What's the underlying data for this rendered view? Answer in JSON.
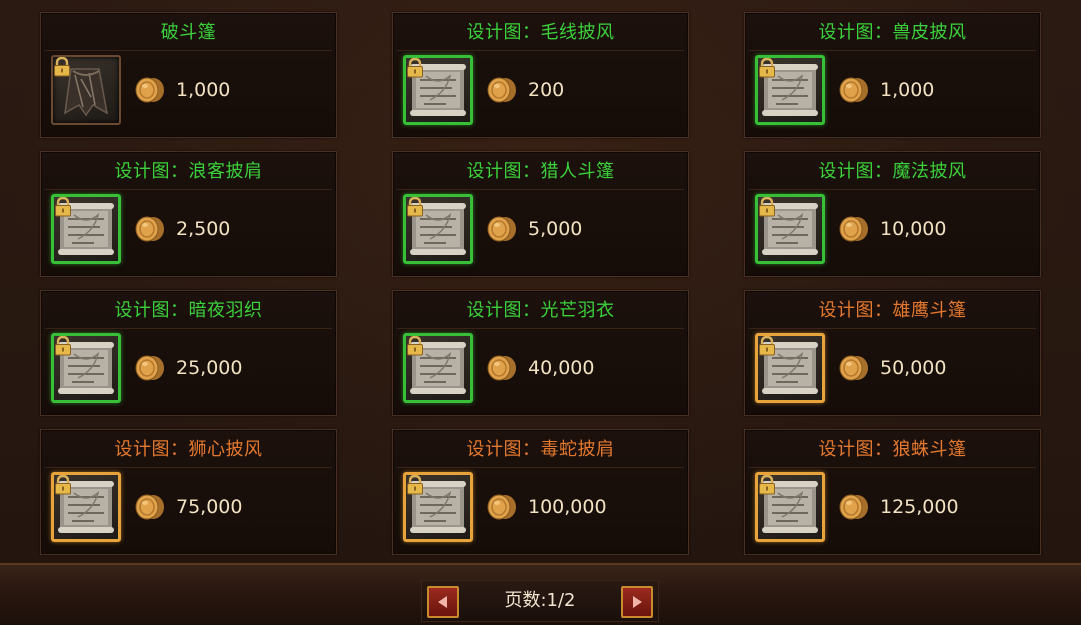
{
  "items": [
    {
      "title": "破斗篷",
      "price": "1,000",
      "rarity": "green",
      "icon": "cloak-icon",
      "frame": "plain"
    },
    {
      "title": "设计图：毛线披风",
      "price": "200",
      "rarity": "green",
      "icon": "scroll-icon",
      "frame": "green"
    },
    {
      "title": "设计图：兽皮披风",
      "price": "1,000",
      "rarity": "green",
      "icon": "scroll-icon",
      "frame": "green"
    },
    {
      "title": "设计图：浪客披肩",
      "price": "2,500",
      "rarity": "green",
      "icon": "scroll-icon",
      "frame": "green"
    },
    {
      "title": "设计图：猎人斗篷",
      "price": "5,000",
      "rarity": "green",
      "icon": "scroll-icon",
      "frame": "green"
    },
    {
      "title": "设计图：魔法披风",
      "price": "10,000",
      "rarity": "green",
      "icon": "scroll-icon",
      "frame": "green"
    },
    {
      "title": "设计图：暗夜羽织",
      "price": "25,000",
      "rarity": "green",
      "icon": "scroll-icon",
      "frame": "green"
    },
    {
      "title": "设计图：光芒羽衣",
      "price": "40,000",
      "rarity": "green",
      "icon": "scroll-icon",
      "frame": "green"
    },
    {
      "title": "设计图：雄鹰斗篷",
      "price": "50,000",
      "rarity": "orange",
      "icon": "scroll-icon",
      "frame": "orange"
    },
    {
      "title": "设计图：狮心披风",
      "price": "75,000",
      "rarity": "orange",
      "icon": "scroll-icon",
      "frame": "orange"
    },
    {
      "title": "设计图：毒蛇披肩",
      "price": "100,000",
      "rarity": "orange",
      "icon": "scroll-icon",
      "frame": "orange"
    },
    {
      "title": "设计图：狼蛛斗篷",
      "price": "125,000",
      "rarity": "orange",
      "icon": "scroll-icon",
      "frame": "orange"
    }
  ],
  "pagination": {
    "label": "页数:1/2",
    "prev_icon": "arrow-left-icon",
    "next_icon": "arrow-right-icon"
  },
  "colors": {
    "green": "#3bd13b",
    "orange": "#e3782e",
    "price": "#f2e2c2"
  }
}
